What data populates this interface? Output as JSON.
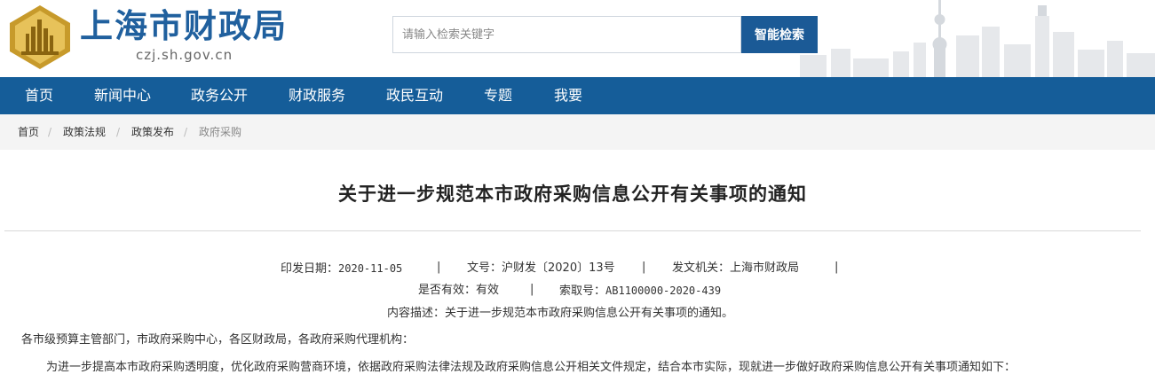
{
  "header": {
    "site_name": "上海市财政局",
    "site_domain": "czj.sh.gov.cn",
    "search_placeholder": "请输入检索关键字",
    "search_button": "智能检索"
  },
  "nav": {
    "items": [
      "首页",
      "新闻中心",
      "政务公开",
      "财政服务",
      "政民互动",
      "专题",
      "我要"
    ]
  },
  "breadcrumb": {
    "items": [
      "首页",
      "政策法规",
      "政策发布",
      "政府采购"
    ],
    "separator": "/"
  },
  "article": {
    "title": "关于进一步规范本市政府采购信息公开有关事项的通知",
    "meta": {
      "issue_date_label": "印发日期：",
      "issue_date": "2020-11-05",
      "doc_no_label": "文号：",
      "doc_no": "沪财发〔2020〕13号",
      "issuer_label": "发文机关：",
      "issuer": "上海市财政局",
      "valid_label": "是否有效：",
      "valid": "有效",
      "index_label": "索取号：",
      "index_no": "AB1100000-2020-439",
      "desc_label": "内容描述：",
      "desc": "关于进一步规范本市政府采购信息公开有关事项的通知。"
    },
    "salutation": "各市级预算主管部门，市政府采购中心，各区财政局，各政府采购代理机构：",
    "paragraph1": "为进一步提高本市政府采购透明度，优化政府采购营商环境，依据政府采购法律法规及政府采购信息公开相关文件规定，结合本市实际，现就进一步做好政府采购信息公开有关事项通知如下："
  },
  "colors": {
    "brand_blue": "#155d99",
    "title_blue": "#20609e",
    "logo_gold": "#c79a2b"
  }
}
